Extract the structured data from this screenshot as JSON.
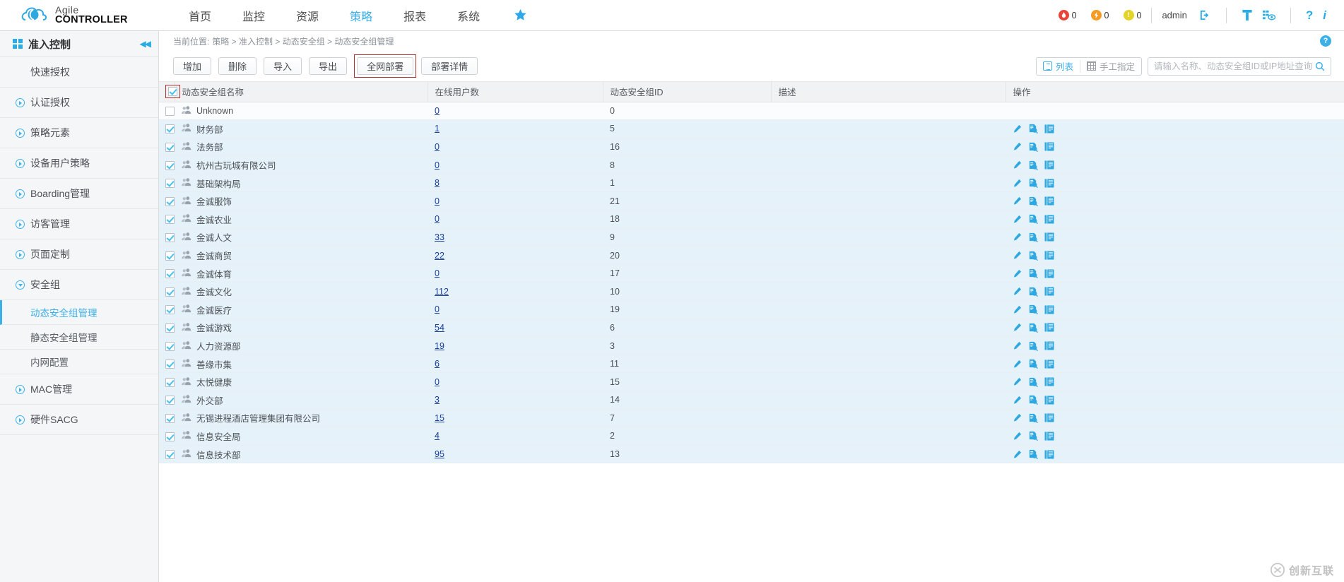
{
  "header": {
    "logo_line1": "Agile",
    "logo_line2": "CONTROLLER",
    "nav": [
      {
        "label": "首页",
        "active": false
      },
      {
        "label": "监控",
        "active": false
      },
      {
        "label": "资源",
        "active": false
      },
      {
        "label": "策略",
        "active": true
      },
      {
        "label": "报表",
        "active": false
      },
      {
        "label": "系统",
        "active": false
      }
    ],
    "star_icon": "star-icon",
    "alarms": [
      {
        "name": "critical-alarm",
        "count": "0",
        "color": "#e8443a",
        "glyph": "●"
      },
      {
        "name": "major-alarm",
        "count": "0",
        "color": "#f59a23",
        "glyph": "⚡"
      },
      {
        "name": "minor-alarm",
        "count": "0",
        "color": "#e3d32a",
        "glyph": "!"
      }
    ],
    "admin": "admin",
    "icons": [
      "logout-icon",
      "tool-icon",
      "monitor-eye-icon",
      "help-icon",
      "info-icon"
    ]
  },
  "sidebar": {
    "title": "准入控制",
    "collapse_icon": "collapse-icon",
    "items": [
      {
        "label": "快速授权",
        "type": "plain"
      },
      {
        "label": "认证授权",
        "type": "expandable"
      },
      {
        "label": "策略元素",
        "type": "expandable"
      },
      {
        "label": "设备用户策略",
        "type": "expandable"
      },
      {
        "label": "Boarding管理",
        "type": "expandable"
      },
      {
        "label": "访客管理",
        "type": "expandable"
      },
      {
        "label": "页面定制",
        "type": "expandable"
      },
      {
        "label": "安全组",
        "type": "expanded"
      }
    ],
    "subitems": [
      {
        "label": "动态安全组管理",
        "active": true
      },
      {
        "label": "静态安全组管理",
        "active": false
      },
      {
        "label": "内网配置",
        "active": false
      }
    ],
    "items_after": [
      {
        "label": "MAC管理",
        "type": "expandable"
      },
      {
        "label": "硬件SACG",
        "type": "expandable"
      }
    ]
  },
  "breadcrumb": {
    "prefix": "当前位置:",
    "path": "策略 > 准入控制 > 动态安全组 > 动态安全组管理",
    "help_label": "?"
  },
  "toolbar": {
    "buttons": [
      {
        "label": "增加",
        "highlighted": false
      },
      {
        "label": "删除",
        "highlighted": false
      },
      {
        "label": "导入",
        "highlighted": false
      },
      {
        "label": "导出",
        "highlighted": false
      },
      {
        "label": "全网部署",
        "highlighted": true
      },
      {
        "label": "部署详情",
        "highlighted": false
      }
    ],
    "view_modes": [
      {
        "label": "列表",
        "icon": "list-view-icon",
        "active": true
      },
      {
        "label": "手工指定",
        "icon": "grid-view-icon",
        "active": false
      }
    ],
    "search_placeholder": "请输入名称、动态安全组ID或IP地址查询",
    "search_value": "",
    "search_icon": "search-icon"
  },
  "table": {
    "columns": [
      "动态安全组名称",
      "在线用户数",
      "动态安全组ID",
      "描述",
      "操作"
    ],
    "header_checkbox_checked": true,
    "ops_icons": [
      "edit-icon",
      "detail-search-icon",
      "list-detail-icon"
    ],
    "rows": [
      {
        "checked": false,
        "name": "Unknown",
        "online": "0",
        "gid": "0",
        "desc": "",
        "ops": false
      },
      {
        "checked": true,
        "name": "财务部",
        "online": "1",
        "gid": "5",
        "desc": "",
        "ops": true
      },
      {
        "checked": true,
        "name": "法务部",
        "online": "0",
        "gid": "16",
        "desc": "",
        "ops": true
      },
      {
        "checked": true,
        "name": "杭州古玩城有限公司",
        "online": "0",
        "gid": "8",
        "desc": "",
        "ops": true
      },
      {
        "checked": true,
        "name": "基础架构局",
        "online": "8",
        "gid": "1",
        "desc": "",
        "ops": true
      },
      {
        "checked": true,
        "name": "金诚服饰",
        "online": "0",
        "gid": "21",
        "desc": "",
        "ops": true
      },
      {
        "checked": true,
        "name": "金诚农业",
        "online": "0",
        "gid": "18",
        "desc": "",
        "ops": true
      },
      {
        "checked": true,
        "name": "金诚人文",
        "online": "33",
        "gid": "9",
        "desc": "",
        "ops": true
      },
      {
        "checked": true,
        "name": "金诚商贸",
        "online": "22",
        "gid": "20",
        "desc": "",
        "ops": true
      },
      {
        "checked": true,
        "name": "金诚体育",
        "online": "0",
        "gid": "17",
        "desc": "",
        "ops": true
      },
      {
        "checked": true,
        "name": "金诚文化",
        "online": "112",
        "gid": "10",
        "desc": "",
        "ops": true
      },
      {
        "checked": true,
        "name": "金诚医疗",
        "online": "0",
        "gid": "19",
        "desc": "",
        "ops": true
      },
      {
        "checked": true,
        "name": "金诚游戏",
        "online": "54",
        "gid": "6",
        "desc": "",
        "ops": true
      },
      {
        "checked": true,
        "name": "人力资源部",
        "online": "19",
        "gid": "3",
        "desc": "",
        "ops": true
      },
      {
        "checked": true,
        "name": "善缘市集",
        "online": "6",
        "gid": "11",
        "desc": "",
        "ops": true
      },
      {
        "checked": true,
        "name": "太悦健康",
        "online": "0",
        "gid": "15",
        "desc": "",
        "ops": true
      },
      {
        "checked": true,
        "name": "外交部",
        "online": "3",
        "gid": "14",
        "desc": "",
        "ops": true
      },
      {
        "checked": true,
        "name": "无锡进程酒店管理集团有限公司",
        "online": "15",
        "gid": "7",
        "desc": "",
        "ops": true
      },
      {
        "checked": true,
        "name": "信息安全局",
        "online": "4",
        "gid": "2",
        "desc": "",
        "ops": true
      },
      {
        "checked": true,
        "name": "信息技术部",
        "online": "95",
        "gid": "13",
        "desc": "",
        "ops": true
      }
    ]
  },
  "watermark": {
    "text": "创新互联",
    "icon": "watermark-logo-icon"
  }
}
